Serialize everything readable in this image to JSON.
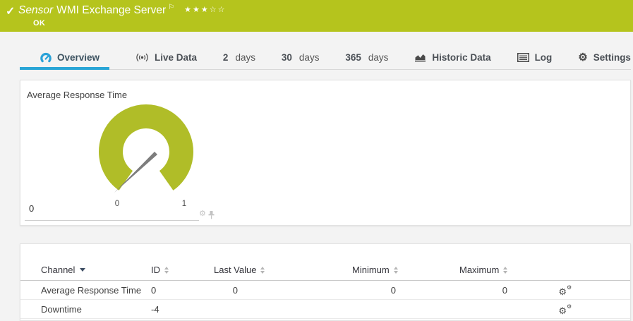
{
  "header": {
    "check_icon": "✓",
    "kind": "Sensor",
    "title": "WMI Exchange Server",
    "flag_icon": "⚐",
    "stars_filled": "★★★",
    "stars_empty": "☆☆",
    "status": "OK",
    "accent_color": "#b5c41d"
  },
  "tabs": {
    "overview": "Overview",
    "live_data": "Live Data",
    "days2_num": "2",
    "days2_word": "days",
    "days30_num": "30",
    "days30_word": "days",
    "days365_num": "365",
    "days365_word": "days",
    "historic": "Historic Data",
    "log": "Log",
    "settings": "Settings",
    "settings_gear_icon": "⚙",
    "active_underline_color": "#29a5d6"
  },
  "gauge": {
    "title": "Average Response Time",
    "value": 0,
    "scale_min": "0",
    "scale_max": "1",
    "axis_zero": "0",
    "ring_color": "#b0bd28",
    "needle_color": "#7d7d7d",
    "gear_icon": "⚙"
  },
  "table": {
    "headers": {
      "channel": "Channel",
      "id": "ID",
      "last_value": "Last Value",
      "minimum": "Minimum",
      "maximum": "Maximum"
    },
    "rows": [
      {
        "channel": "Average Response Time",
        "id": "0",
        "last_value": "0",
        "minimum": "0",
        "maximum": "0"
      },
      {
        "channel": "Downtime",
        "id": "-4",
        "last_value": "",
        "minimum": "",
        "maximum": ""
      }
    ],
    "row_gear_icon": "⚙"
  }
}
